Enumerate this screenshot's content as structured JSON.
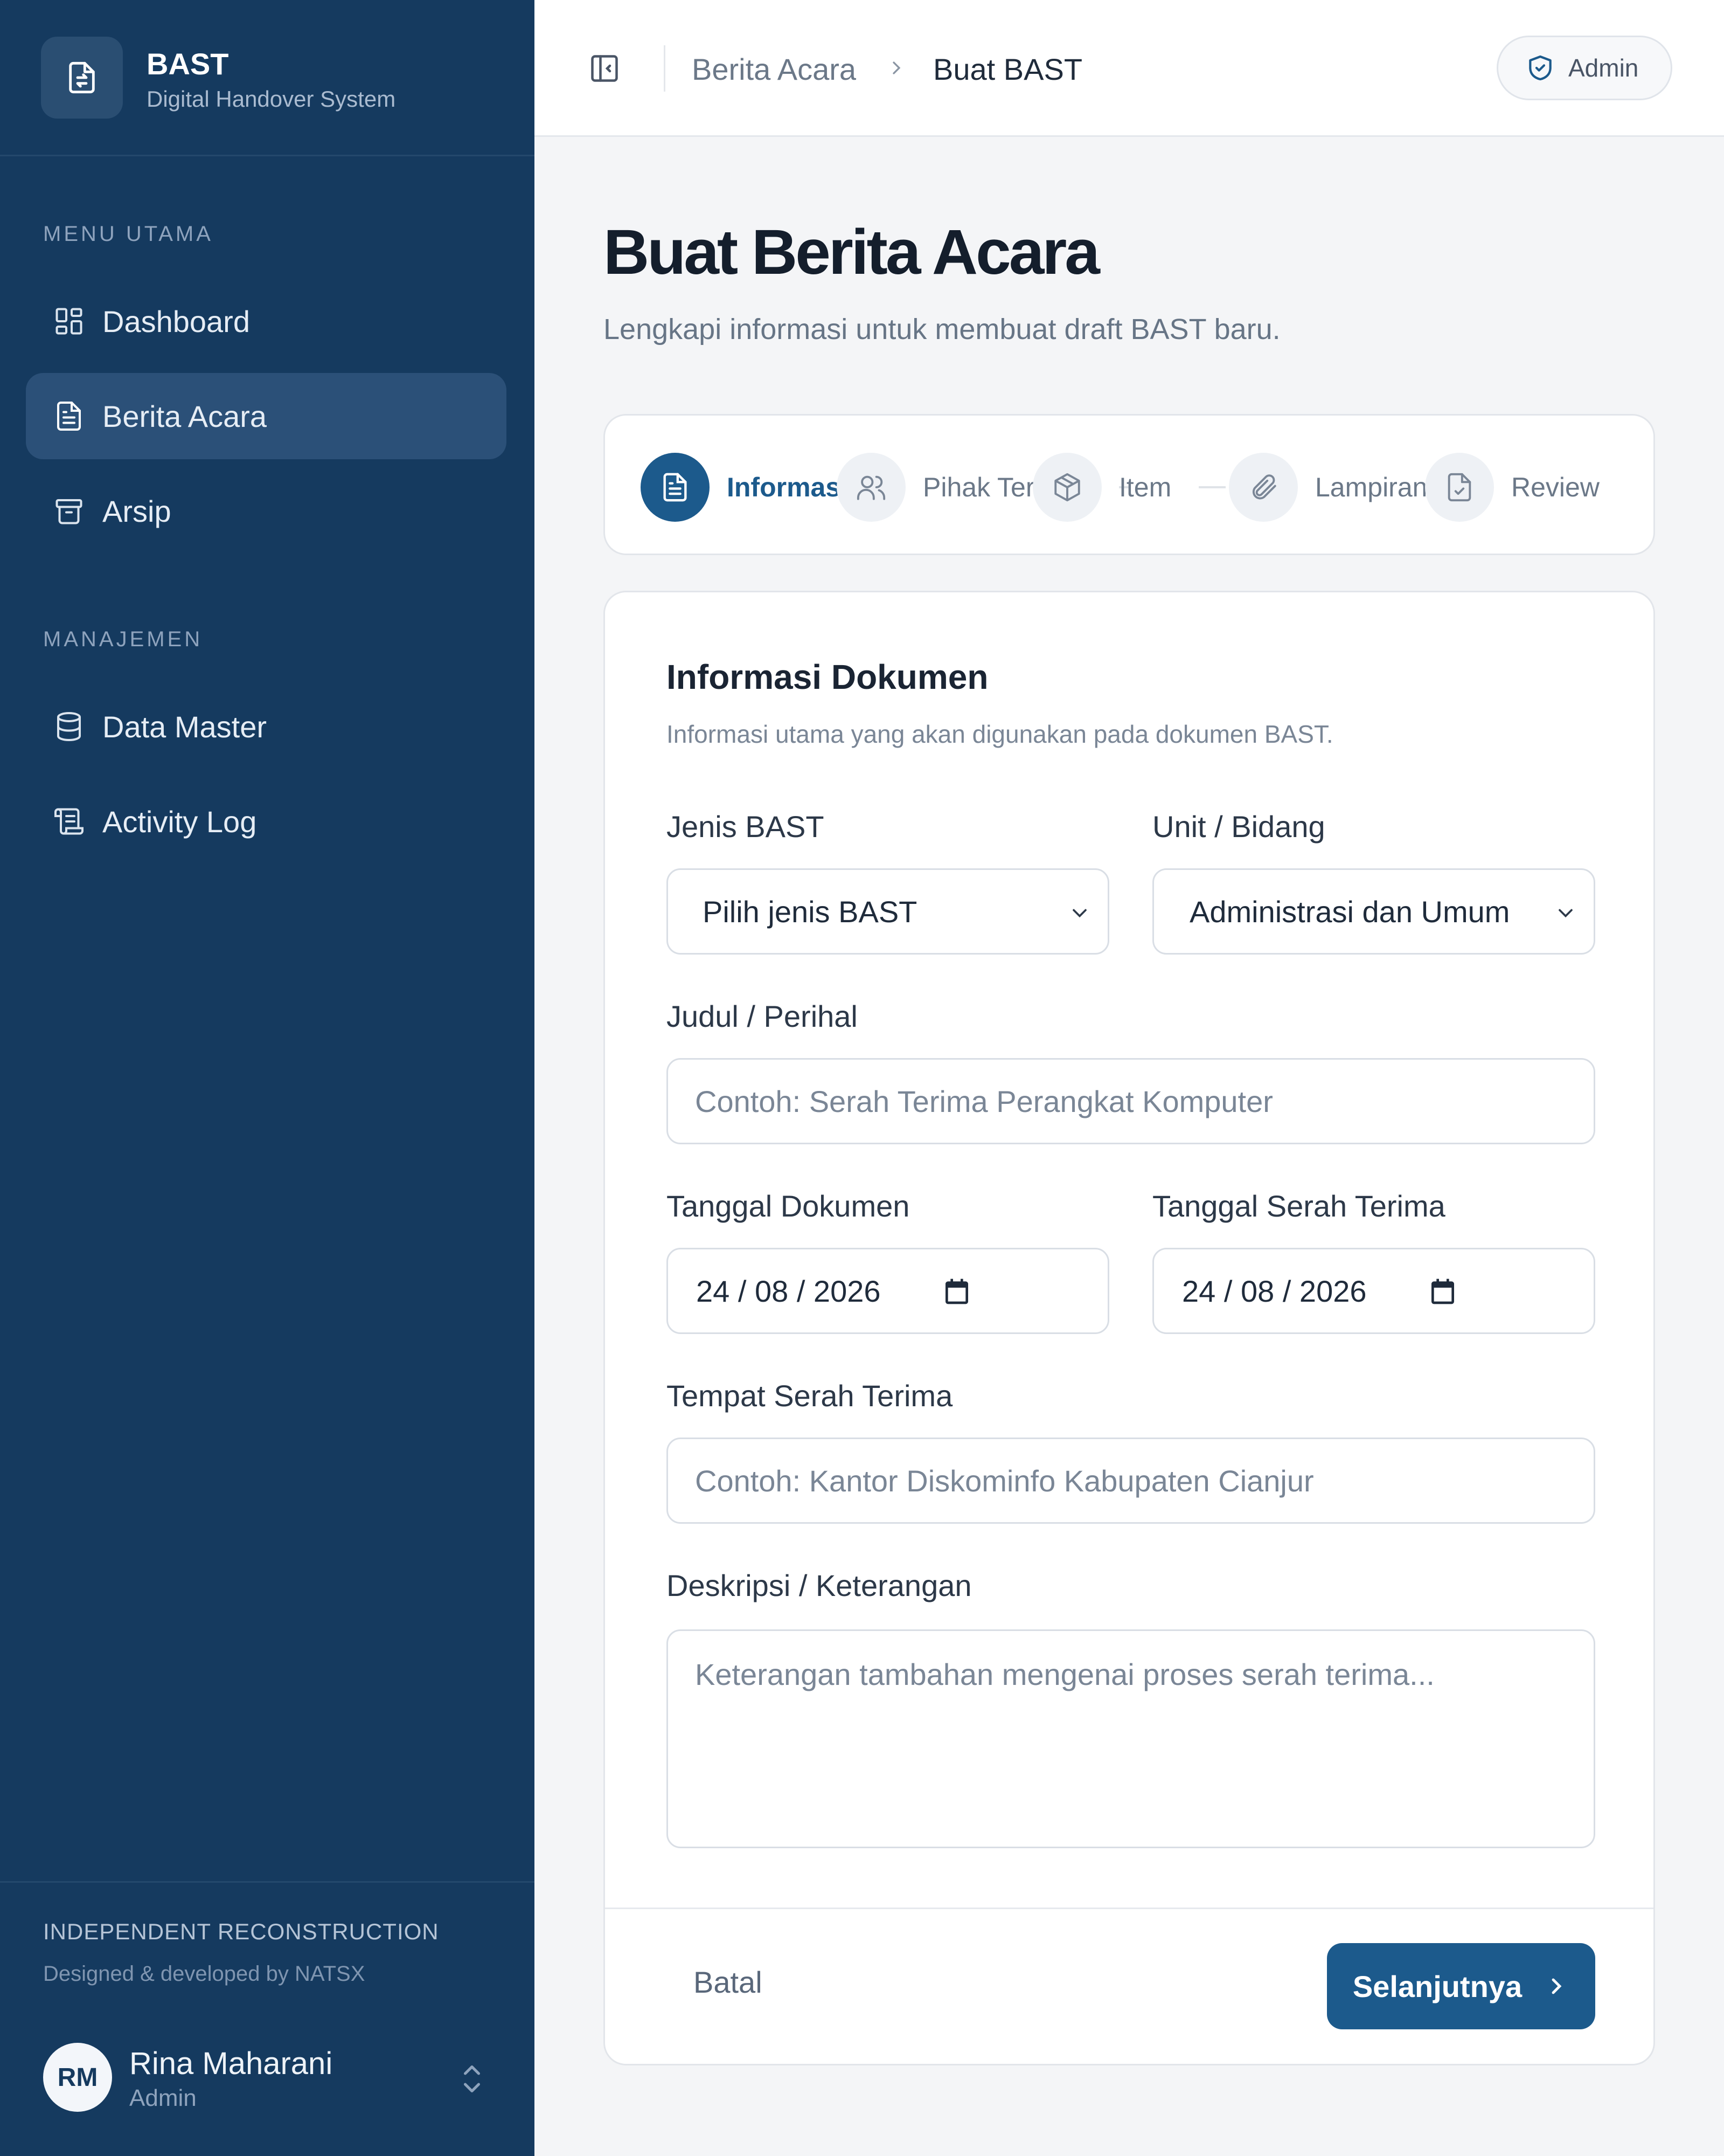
{
  "sidebar": {
    "brand": {
      "title": "BAST",
      "subtitle": "Digital Handover System",
      "logo_icon": "document-transfer-icon"
    },
    "sections": [
      {
        "label": "MENU UTAMA",
        "items": [
          {
            "label": "Dashboard",
            "icon": "dashboard-grid-icon",
            "active": false
          },
          {
            "label": "Berita Acara",
            "icon": "document-icon",
            "active": true
          },
          {
            "label": "Arsip",
            "icon": "archive-box-icon",
            "active": false
          }
        ]
      },
      {
        "label": "MANAJEMEN",
        "items": [
          {
            "label": "Data Master",
            "icon": "database-icon",
            "active": false
          },
          {
            "label": "Activity Log",
            "icon": "scroll-icon",
            "active": false
          }
        ]
      }
    ],
    "footer": {
      "title": "INDEPENDENT RECONSTRUCTION",
      "subtitle": "Designed & developed by NATSX"
    },
    "user": {
      "initials": "RM",
      "name": "Rina Maharani",
      "role": "Admin"
    }
  },
  "topbar": {
    "breadcrumb": [
      "Berita Acara",
      "Buat BAST"
    ],
    "role_badge": "Admin"
  },
  "page": {
    "title": "Buat Berita Acara",
    "subtitle": "Lengkapi informasi untuk membuat draft BAST baru."
  },
  "stepper": {
    "steps": [
      {
        "label": "Informasi",
        "icon": "document-icon",
        "active": true
      },
      {
        "label": "Pihak Ter",
        "icon": "users-icon",
        "active": false
      },
      {
        "label": "Item",
        "icon": "package-icon",
        "active": false
      },
      {
        "label": "Lampiran",
        "icon": "paperclip-icon",
        "active": false
      },
      {
        "label": "Review",
        "icon": "file-check-icon",
        "active": false
      }
    ]
  },
  "form": {
    "title": "Informasi Dokumen",
    "subtitle": "Informasi utama yang akan digunakan pada dokumen BAST.",
    "jenis": {
      "label": "Jenis BAST",
      "value": "Pilih jenis BAST"
    },
    "unit": {
      "label": "Unit / Bidang",
      "value": "Administrasi dan Umum"
    },
    "judul": {
      "label": "Judul / Perihal",
      "placeholder": "Contoh: Serah Terima Perangkat Komputer"
    },
    "tanggal_dokumen": {
      "label": "Tanggal Dokumen",
      "value": "24 / 08 / 2026"
    },
    "tanggal_serah": {
      "label": "Tanggal Serah Terima",
      "value": "24 / 08 / 2026"
    },
    "tempat": {
      "label": "Tempat Serah Terima",
      "placeholder": "Contoh: Kantor Diskominfo Kabupaten Cianjur"
    },
    "deskripsi": {
      "label": "Deskripsi / Keterangan",
      "placeholder": "Keterangan tambahan mengenai proses serah terima..."
    }
  },
  "actions": {
    "cancel": "Batal",
    "next": "Selanjutnya"
  },
  "colors": {
    "sidebar_bg": "#153a5f",
    "accent": "#1c5a8c",
    "page_bg": "#f4f5f7"
  }
}
